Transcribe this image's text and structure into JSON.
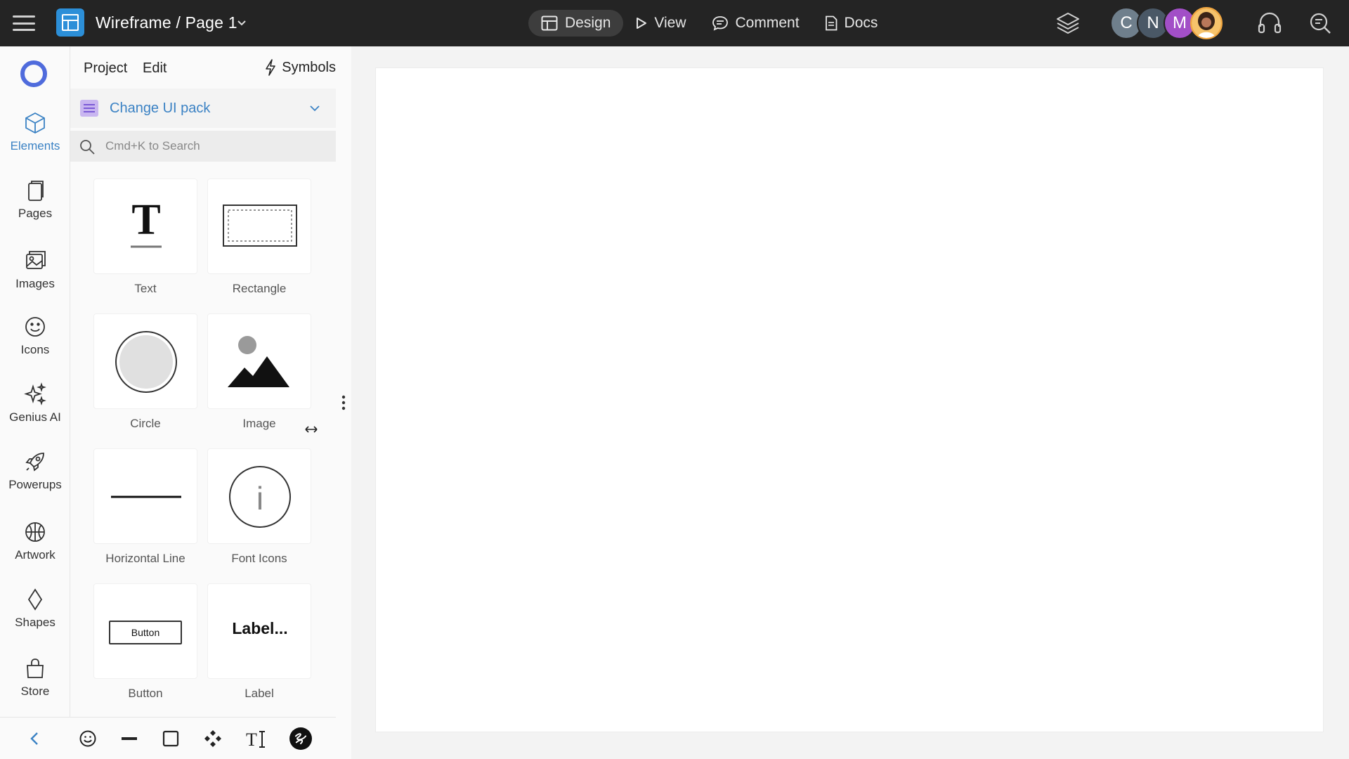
{
  "topbar": {
    "title": "Wireframe / Page 1",
    "nav": [
      {
        "label": "Design",
        "active": true
      },
      {
        "label": "View",
        "active": false
      },
      {
        "label": "Comment",
        "active": false
      },
      {
        "label": "Docs",
        "active": false
      }
    ],
    "avatars": [
      {
        "initial": "C",
        "color": "#6f7f8c"
      },
      {
        "initial": "N",
        "color": "#4a5866"
      },
      {
        "initial": "M",
        "color": "#a24fc7"
      },
      {
        "initial": "",
        "color": "#e08a2e"
      }
    ]
  },
  "rail": {
    "items": [
      {
        "label": "Elements",
        "icon": "cube-icon",
        "active": true
      },
      {
        "label": "Pages",
        "icon": "pages-icon"
      },
      {
        "label": "Images",
        "icon": "images-icon"
      },
      {
        "label": "Icons",
        "icon": "smiley-icon"
      },
      {
        "label": "Genius AI",
        "icon": "sparkle-icon"
      },
      {
        "label": "Powerups",
        "icon": "rocket-icon"
      },
      {
        "label": "Artwork",
        "icon": "ball-icon"
      },
      {
        "label": "Shapes",
        "icon": "diamond-icon"
      },
      {
        "label": "Store",
        "icon": "bag-icon"
      }
    ]
  },
  "panel": {
    "tabs": {
      "project": "Project",
      "edit": "Edit",
      "symbols": "Symbols"
    },
    "uipack": "Change UI pack",
    "search_placeholder": "Cmd+K to Search",
    "tiles": [
      {
        "label": "Text",
        "glyph": "T"
      },
      {
        "label": "Rectangle"
      },
      {
        "label": "Circle"
      },
      {
        "label": "Image"
      },
      {
        "label": "Horizontal Line"
      },
      {
        "label": "Font Icons",
        "glyph": "i"
      },
      {
        "label": "Button",
        "button_text": "Button"
      },
      {
        "label": "Label",
        "label_text": "Label..."
      }
    ]
  },
  "colors": {
    "topbar": "#242424",
    "accent": "#3b82c4",
    "rail_logo": "#4f6bdc"
  }
}
